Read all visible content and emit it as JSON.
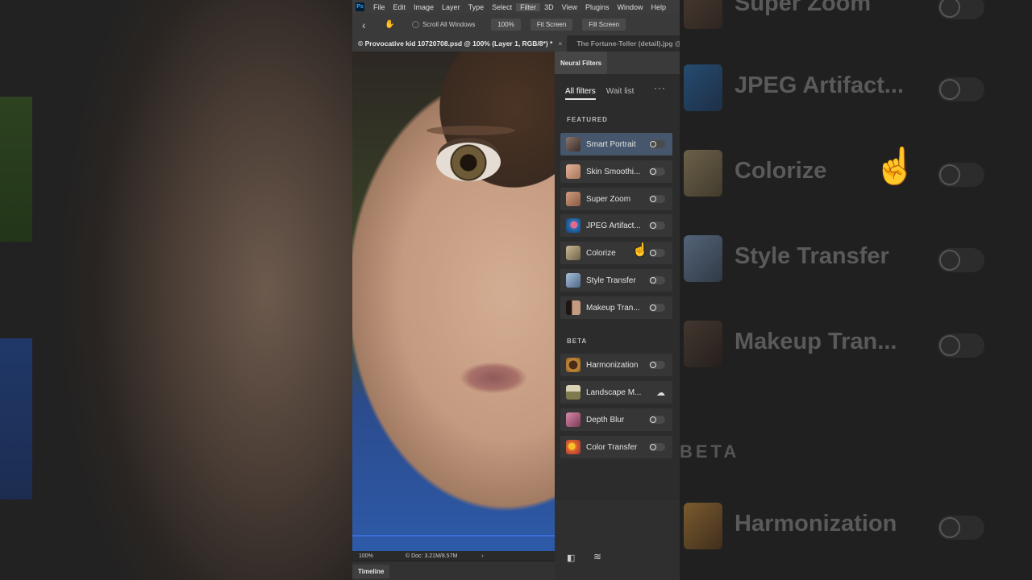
{
  "menubar": {
    "logo": "Ps",
    "items": [
      "File",
      "Edit",
      "Image",
      "Layer",
      "Type",
      "Select",
      "Filter",
      "3D",
      "View",
      "Plugins",
      "Window",
      "Help"
    ],
    "active": "Filter"
  },
  "options": {
    "scroll_all": "Scroll All Windows",
    "zoom": "100%",
    "fit_screen": "Fit Screen",
    "fill_screen": "Fill Screen"
  },
  "tabs": {
    "active": "© Provocative kid 10720708.psd @ 100% (Layer 1, RGB/8*) *",
    "close": "×",
    "second": "The Fortune-Teller (detail).jpg @ 85"
  },
  "status": {
    "zoom": "100%",
    "doc": "© Doc: 3.21M/8.57M",
    "arrow": "›"
  },
  "timeline": {
    "label": "Timeline"
  },
  "neural_filters": {
    "title": "Neural Filters",
    "tab_all": "All filters",
    "tab_wait": "Wait list",
    "more": "···",
    "featured_heading": "FEATURED",
    "featured": [
      {
        "label": "Smart Portrait",
        "thumb": "#5a4a44"
      },
      {
        "label": "Skin Smoothi...",
        "thumb": "#c9987a"
      },
      {
        "label": "Super Zoom",
        "thumb": "#b9856b"
      },
      {
        "label": "JPEG Artifact...",
        "thumb": "#2b6fb3"
      },
      {
        "label": "Colorize",
        "thumb": "#a8946a"
      },
      {
        "label": "Style Transfer",
        "thumb": "#7e9bc0"
      },
      {
        "label": "Makeup Tran...",
        "thumb": "#3b2a22"
      }
    ],
    "beta_heading": "BETA",
    "beta": [
      {
        "label": "Harmonization",
        "thumb": "#c48b3a",
        "control": "toggle"
      },
      {
        "label": "Landscape M...",
        "thumb": "#a9a173",
        "control": "cloud",
        "icon": "cloud-download-icon"
      },
      {
        "label": "Depth Blur",
        "thumb": "#b56a8a",
        "control": "toggle"
      },
      {
        "label": "Color Transfer",
        "thumb": "#e06a2a",
        "control": "toggle"
      }
    ]
  },
  "background_panel": {
    "items": [
      "Super Zoom",
      "JPEG Artifact...",
      "Colorize",
      "Style Transfer",
      "Makeup Tran..."
    ],
    "section": "BETA",
    "beta_item": "Harmonization"
  }
}
